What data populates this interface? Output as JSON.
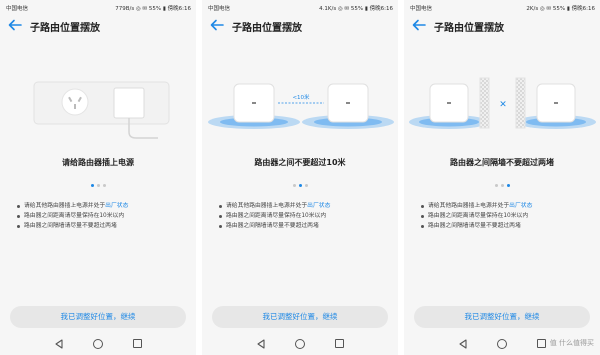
{
  "screens": [
    {
      "status": {
        "carrier": "中国电信",
        "right": "779B/s ◎ ✉ 55% ▮ 傍晚6:16"
      },
      "title": "子路由位置摆放",
      "caption": "请给路由器插上电源",
      "tips": [
        {
          "text": "请给其他路由器插上电源并处于",
          "highlight": "出厂状态"
        },
        {
          "text": "路由器之间距离请尽量保持在10米以内",
          "highlight": ""
        },
        {
          "text": "路由器之间隔墙请尽量不要超过两堵",
          "highlight": ""
        }
      ],
      "active_dot": 0,
      "cta": "我已调整好位置，继续"
    },
    {
      "status": {
        "carrier": "中国电信",
        "right": "4.1K/s ◎ ✉ 55% ▮ 傍晚6:16"
      },
      "title": "子路由位置摆放",
      "caption": "路由器之间不要超过10米",
      "distance_label": "<10米",
      "tips": [
        {
          "text": "请给其他路由器插上电源并处于",
          "highlight": "出厂状态"
        },
        {
          "text": "路由器之间距离请尽量保持在10米以内",
          "highlight": ""
        },
        {
          "text": "路由器之间隔墙请尽量不要超过两堵",
          "highlight": ""
        }
      ],
      "active_dot": 1,
      "cta": "我已调整好位置，继续"
    },
    {
      "status": {
        "carrier": "中国电信",
        "right": "2K/s ◎ ✉ 55% ▮ 傍晚6:16"
      },
      "title": "子路由位置摆放",
      "caption": "路由器之间隔墙不要超过两堵",
      "tips": [
        {
          "text": "请给其他路由器插上电源并处于",
          "highlight": "出厂状态"
        },
        {
          "text": "路由器之间距离请尽量保持在10米以内",
          "highlight": ""
        },
        {
          "text": "路由器之间隔墙请尽量不要超过两堵",
          "highlight": ""
        }
      ],
      "active_dot": 2,
      "cta": "我已调整好位置，继续"
    }
  ],
  "watermark": "值 什么值得买",
  "colors": {
    "accent": "#1e88e5",
    "background": "#f6f6f6",
    "button": "#e7e7e7",
    "glow": "#4ea3ee"
  }
}
